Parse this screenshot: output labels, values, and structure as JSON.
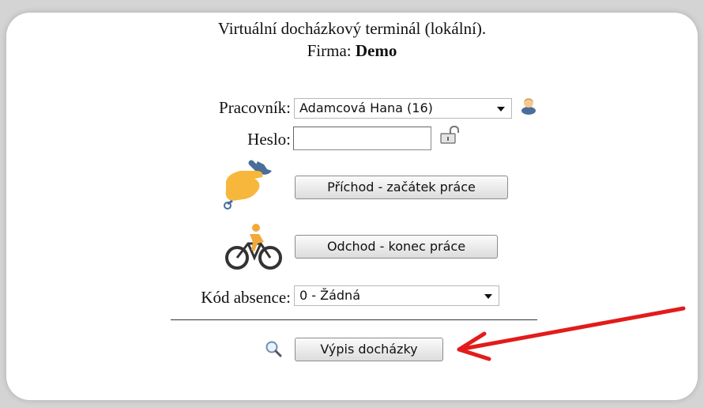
{
  "header": {
    "title": "Virtuální docházkový terminál (lokální).",
    "firma_label": "Firma:",
    "firma_value": "Demo"
  },
  "form": {
    "worker_label": "Pracovník:",
    "worker_value": "Adamcová Hana (16)",
    "password_label": "Heslo:",
    "password_value": "",
    "arrival_button": "Příchod - začátek práce",
    "departure_button": "Odchod - konec práce",
    "absence_label": "Kód absence:",
    "absence_value": "0 - Žádná",
    "report_button": "Výpis docházky"
  },
  "icons": {
    "worker": "user-icon",
    "password": "unlock-icon",
    "arrival": "hand-wrench-icon",
    "departure": "bicycle-icon",
    "report": "search-icon",
    "annotation": "red-arrow-annotation"
  },
  "colors": {
    "hand": "#f6b73c",
    "wrench": "#4a6e9a",
    "bicycle": "#333333",
    "rider": "#f2a93b",
    "arrow": "#e21b1b"
  }
}
